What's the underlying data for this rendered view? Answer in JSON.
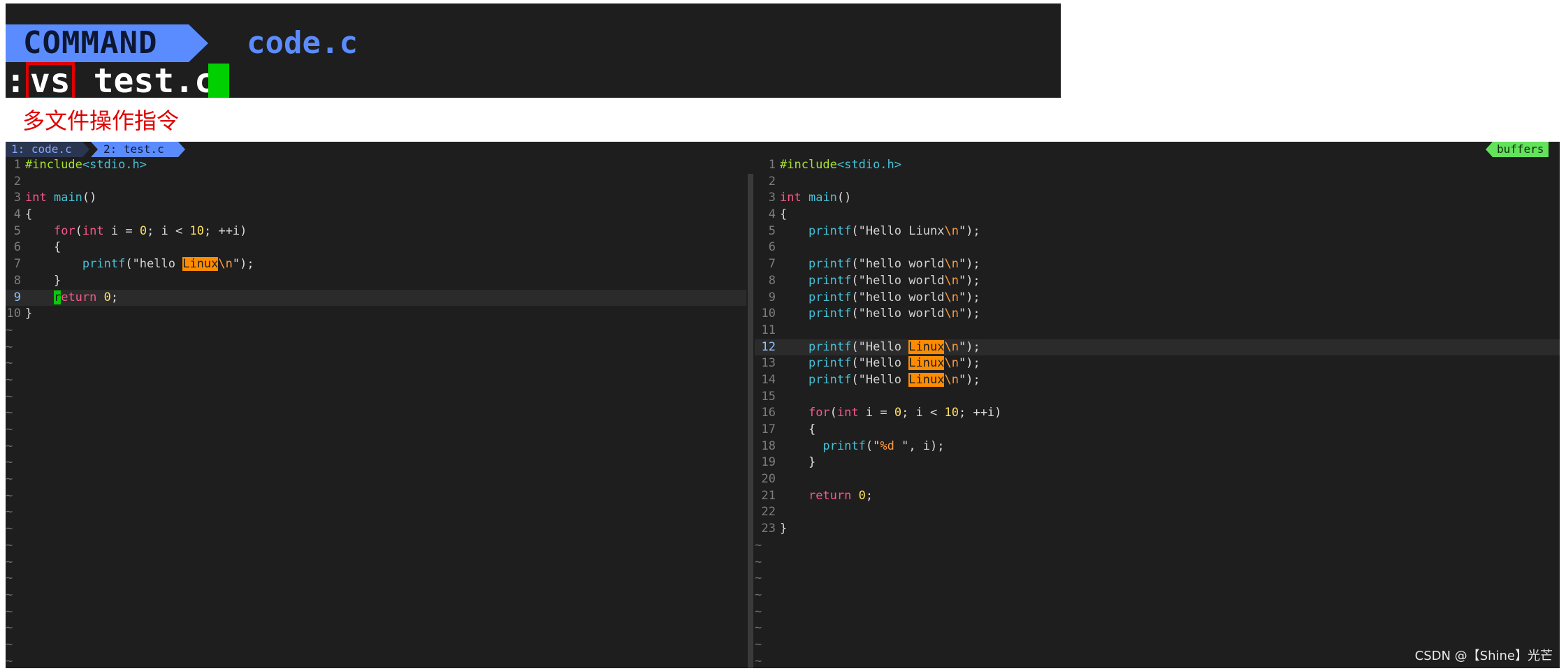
{
  "command_panel": {
    "mode": "COMMAND",
    "file": "code.c",
    "colon": ":",
    "cmd_highlight": "vs",
    "cmd_rest": " test.c"
  },
  "annotation": "多文件操作指令",
  "tabline": {
    "tab1": "1: code.c",
    "tab2": "2: test.c",
    "buffers": "buffers"
  },
  "left_pane": {
    "lines": [
      {
        "n": "1",
        "tokens": [
          [
            "pre",
            "#include"
          ],
          [
            "inc",
            "<stdio.h>"
          ]
        ]
      },
      {
        "n": "2",
        "tokens": []
      },
      {
        "n": "3",
        "tokens": [
          [
            "kw",
            "int"
          ],
          [
            "txt",
            " "
          ],
          [
            "fn",
            "main"
          ],
          [
            "txt",
            "()"
          ]
        ]
      },
      {
        "n": "4",
        "tokens": [
          [
            "txt",
            "{"
          ]
        ]
      },
      {
        "n": "5",
        "tokens": [
          [
            "txt",
            "    "
          ],
          [
            "kw",
            "for"
          ],
          [
            "txt",
            "("
          ],
          [
            "kw",
            "int"
          ],
          [
            "txt",
            " i = "
          ],
          [
            "num",
            "0"
          ],
          [
            "txt",
            "; i < "
          ],
          [
            "num",
            "10"
          ],
          [
            "txt",
            "; ++i)"
          ]
        ]
      },
      {
        "n": "6",
        "tokens": [
          [
            "txt",
            "    {"
          ]
        ]
      },
      {
        "n": "7",
        "tokens": [
          [
            "txt",
            "        "
          ],
          [
            "fn",
            "printf"
          ],
          [
            "txt",
            "("
          ],
          [
            "str",
            "\"hello "
          ],
          [
            "hl",
            "Linux"
          ],
          [
            "esc",
            "\\n"
          ],
          [
            "str",
            "\""
          ],
          [
            "txt",
            ");"
          ]
        ]
      },
      {
        "n": "8",
        "tokens": [
          [
            "txt",
            "    }"
          ]
        ]
      },
      {
        "n": "9",
        "cur": true,
        "tokens": [
          [
            "txt",
            "    "
          ],
          [
            "cur-block",
            "r"
          ],
          [
            "kw",
            "eturn"
          ],
          [
            "txt",
            " "
          ],
          [
            "num",
            "0"
          ],
          [
            "txt",
            ";"
          ]
        ]
      },
      {
        "n": "10",
        "tokens": [
          [
            "txt",
            "}"
          ]
        ]
      }
    ],
    "tilde_count": 21
  },
  "right_pane": {
    "lines": [
      {
        "n": "1",
        "tokens": [
          [
            "pre",
            "#include"
          ],
          [
            "inc",
            "<stdio.h>"
          ]
        ]
      },
      {
        "n": "2",
        "tokens": []
      },
      {
        "n": "3",
        "tokens": [
          [
            "kw",
            "int"
          ],
          [
            "txt",
            " "
          ],
          [
            "fn",
            "main"
          ],
          [
            "txt",
            "()"
          ]
        ]
      },
      {
        "n": "4",
        "tokens": [
          [
            "txt",
            "{"
          ]
        ]
      },
      {
        "n": "5",
        "tokens": [
          [
            "txt",
            "    "
          ],
          [
            "fn",
            "printf"
          ],
          [
            "txt",
            "("
          ],
          [
            "str",
            "\"Hello Liunx"
          ],
          [
            "esc",
            "\\n"
          ],
          [
            "str",
            "\""
          ],
          [
            "txt",
            ");"
          ]
        ]
      },
      {
        "n": "6",
        "tokens": []
      },
      {
        "n": "7",
        "tokens": [
          [
            "txt",
            "    "
          ],
          [
            "fn",
            "printf"
          ],
          [
            "txt",
            "("
          ],
          [
            "str",
            "\"hello world"
          ],
          [
            "esc",
            "\\n"
          ],
          [
            "str",
            "\""
          ],
          [
            "txt",
            ");"
          ]
        ]
      },
      {
        "n": "8",
        "tokens": [
          [
            "txt",
            "    "
          ],
          [
            "fn",
            "printf"
          ],
          [
            "txt",
            "("
          ],
          [
            "str",
            "\"hello world"
          ],
          [
            "esc",
            "\\n"
          ],
          [
            "str",
            "\""
          ],
          [
            "txt",
            ");"
          ]
        ]
      },
      {
        "n": "9",
        "tokens": [
          [
            "txt",
            "    "
          ],
          [
            "fn",
            "printf"
          ],
          [
            "txt",
            "("
          ],
          [
            "str",
            "\"hello world"
          ],
          [
            "esc",
            "\\n"
          ],
          [
            "str",
            "\""
          ],
          [
            "txt",
            ");"
          ]
        ]
      },
      {
        "n": "10",
        "tokens": [
          [
            "txt",
            "    "
          ],
          [
            "fn",
            "printf"
          ],
          [
            "txt",
            "("
          ],
          [
            "str",
            "\"hello world"
          ],
          [
            "esc",
            "\\n"
          ],
          [
            "str",
            "\""
          ],
          [
            "txt",
            ");"
          ]
        ]
      },
      {
        "n": "11",
        "tokens": []
      },
      {
        "n": "12",
        "cur": true,
        "tokens": [
          [
            "txt",
            "    "
          ],
          [
            "fn",
            "printf"
          ],
          [
            "txt",
            "("
          ],
          [
            "str",
            "\"Hello "
          ],
          [
            "hl",
            "Linux"
          ],
          [
            "esc",
            "\\n"
          ],
          [
            "str",
            "\""
          ],
          [
            "txt",
            ");"
          ]
        ]
      },
      {
        "n": "13",
        "tokens": [
          [
            "txt",
            "    "
          ],
          [
            "fn",
            "printf"
          ],
          [
            "txt",
            "("
          ],
          [
            "str",
            "\"Hello "
          ],
          [
            "hl",
            "Linux"
          ],
          [
            "esc",
            "\\n"
          ],
          [
            "str",
            "\""
          ],
          [
            "txt",
            ");"
          ]
        ]
      },
      {
        "n": "14",
        "tokens": [
          [
            "txt",
            "    "
          ],
          [
            "fn",
            "printf"
          ],
          [
            "txt",
            "("
          ],
          [
            "str",
            "\"Hello "
          ],
          [
            "hl",
            "Linux"
          ],
          [
            "esc",
            "\\n"
          ],
          [
            "str",
            "\""
          ],
          [
            "txt",
            ");"
          ]
        ]
      },
      {
        "n": "15",
        "tokens": []
      },
      {
        "n": "16",
        "tokens": [
          [
            "txt",
            "    "
          ],
          [
            "kw",
            "for"
          ],
          [
            "txt",
            "("
          ],
          [
            "kw",
            "int"
          ],
          [
            "txt",
            " i = "
          ],
          [
            "num",
            "0"
          ],
          [
            "txt",
            "; i < "
          ],
          [
            "num",
            "10"
          ],
          [
            "txt",
            "; ++i)"
          ]
        ]
      },
      {
        "n": "17",
        "tokens": [
          [
            "txt",
            "    {"
          ]
        ]
      },
      {
        "n": "18",
        "tokens": [
          [
            "txt",
            "      "
          ],
          [
            "fn",
            "printf"
          ],
          [
            "txt",
            "("
          ],
          [
            "str",
            "\""
          ],
          [
            "esc",
            "%d"
          ],
          [
            "str",
            " \""
          ],
          [
            "txt",
            ", i);"
          ]
        ]
      },
      {
        "n": "19",
        "tokens": [
          [
            "txt",
            "    }"
          ]
        ]
      },
      {
        "n": "20",
        "tokens": []
      },
      {
        "n": "21",
        "tokens": [
          [
            "txt",
            "    "
          ],
          [
            "kw",
            "return"
          ],
          [
            "txt",
            " "
          ],
          [
            "num",
            "0"
          ],
          [
            "txt",
            ";"
          ]
        ]
      },
      {
        "n": "22",
        "tokens": []
      },
      {
        "n": "23",
        "tokens": [
          [
            "txt",
            "}"
          ]
        ]
      }
    ],
    "tilde_count": 8
  },
  "watermark": "CSDN @【Shine】光芒"
}
